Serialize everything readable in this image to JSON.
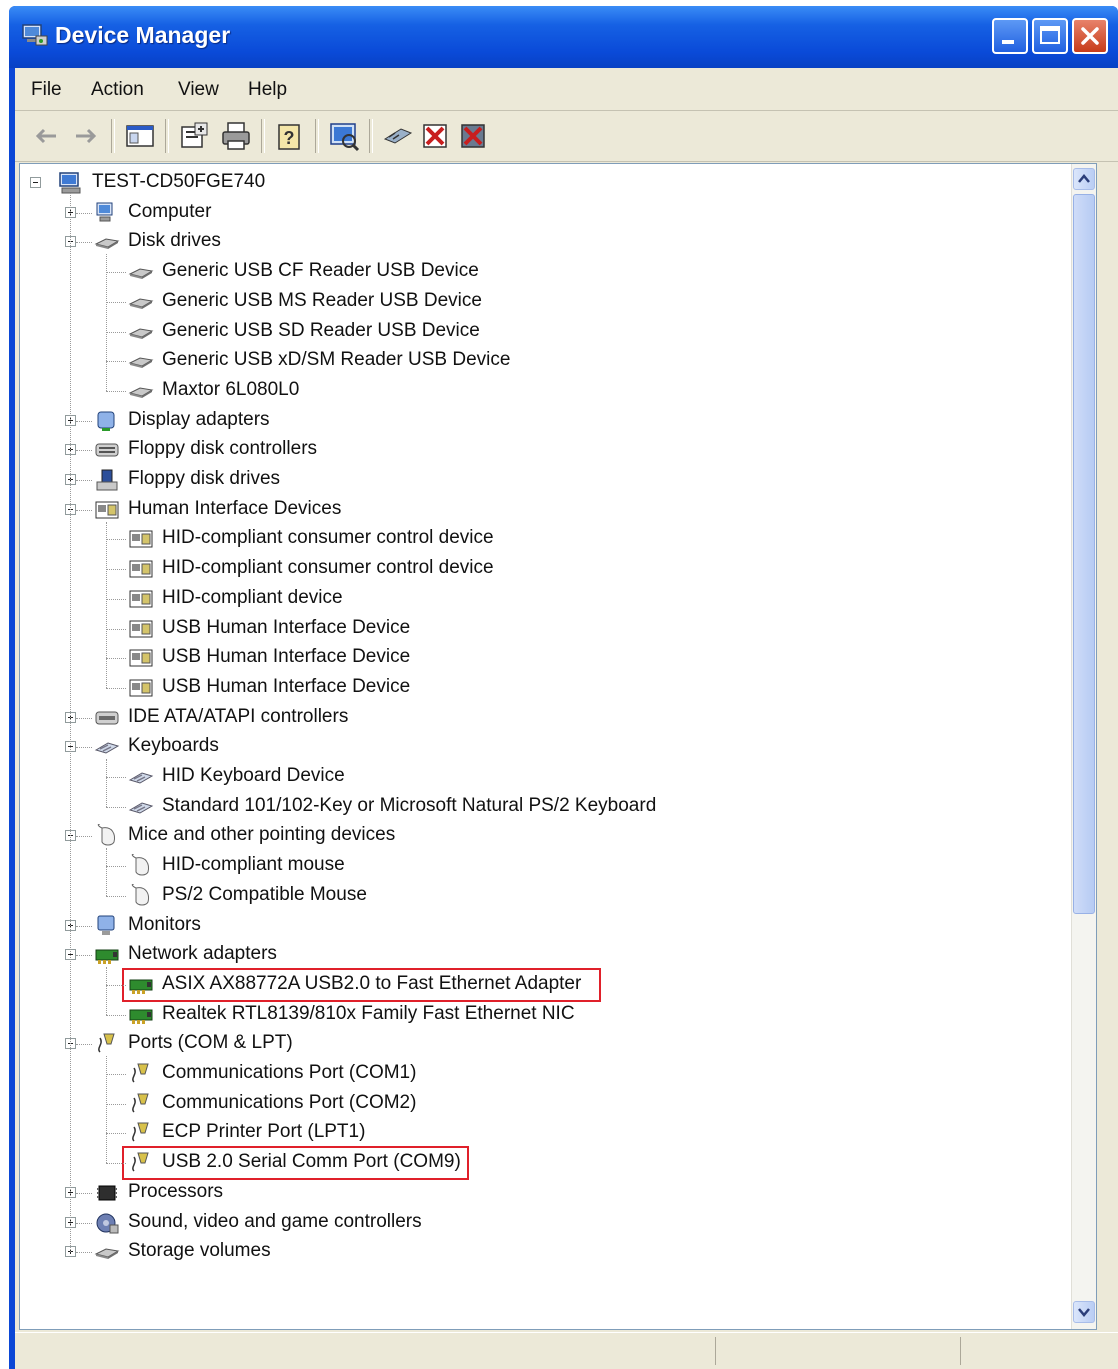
{
  "window": {
    "title": "Device Manager"
  },
  "menu": [
    "File",
    "Action",
    "View",
    "Help"
  ],
  "toolbar": [
    "back-arrow-icon",
    "forward-arrow-icon",
    "console-tree-icon",
    "properties-icon",
    "print-icon",
    "help-icon",
    "scan-hardware-icon",
    "update-driver-icon",
    "disable-device-icon",
    "uninstall-device-icon"
  ],
  "tree": {
    "root": "TEST-CD50FGE740",
    "categories": [
      {
        "label": "Computer",
        "icon": "computer-icon",
        "expanded": false,
        "children": []
      },
      {
        "label": "Disk drives",
        "icon": "disk-drive-icon",
        "expanded": true,
        "children": [
          {
            "label": "Generic USB CF Reader USB Device",
            "icon": "disk-drive-icon"
          },
          {
            "label": "Generic USB MS Reader USB Device",
            "icon": "disk-drive-icon"
          },
          {
            "label": "Generic USB SD Reader USB Device",
            "icon": "disk-drive-icon"
          },
          {
            "label": "Generic USB xD/SM Reader USB Device",
            "icon": "disk-drive-icon"
          },
          {
            "label": "Maxtor 6L080L0",
            "icon": "disk-drive-icon"
          }
        ]
      },
      {
        "label": "Display adapters",
        "icon": "display-adapter-icon",
        "expanded": false,
        "children": []
      },
      {
        "label": "Floppy disk controllers",
        "icon": "floppy-controller-icon",
        "expanded": false,
        "children": []
      },
      {
        "label": "Floppy disk drives",
        "icon": "floppy-drive-icon",
        "expanded": false,
        "children": []
      },
      {
        "label": "Human Interface Devices",
        "icon": "hid-icon",
        "expanded": true,
        "children": [
          {
            "label": "HID-compliant consumer control device",
            "icon": "hid-icon"
          },
          {
            "label": "HID-compliant consumer control device",
            "icon": "hid-icon"
          },
          {
            "label": "HID-compliant device",
            "icon": "hid-icon"
          },
          {
            "label": "USB Human Interface Device",
            "icon": "hid-icon"
          },
          {
            "label": "USB Human Interface Device",
            "icon": "hid-icon"
          },
          {
            "label": "USB Human Interface Device",
            "icon": "hid-icon"
          }
        ]
      },
      {
        "label": "IDE ATA/ATAPI controllers",
        "icon": "ide-controller-icon",
        "expanded": false,
        "children": []
      },
      {
        "label": "Keyboards",
        "icon": "keyboard-icon",
        "expanded": true,
        "children": [
          {
            "label": "HID Keyboard Device",
            "icon": "keyboard-icon"
          },
          {
            "label": "Standard 101/102-Key or Microsoft Natural PS/2 Keyboard",
            "icon": "keyboard-icon"
          }
        ]
      },
      {
        "label": "Mice and other pointing devices",
        "icon": "mouse-icon",
        "expanded": true,
        "children": [
          {
            "label": "HID-compliant mouse",
            "icon": "mouse-icon"
          },
          {
            "label": "PS/2 Compatible Mouse",
            "icon": "mouse-icon"
          }
        ]
      },
      {
        "label": "Monitors",
        "icon": "monitor-icon",
        "expanded": false,
        "children": []
      },
      {
        "label": "Network adapters",
        "icon": "network-adapter-icon",
        "expanded": true,
        "children": [
          {
            "label": "ASIX AX88772A USB2.0 to Fast Ethernet Adapter",
            "icon": "network-adapter-icon",
            "highlighted": true
          },
          {
            "label": "Realtek RTL8139/810x Family Fast Ethernet NIC",
            "icon": "network-adapter-icon"
          }
        ]
      },
      {
        "label": "Ports (COM & LPT)",
        "icon": "port-icon",
        "expanded": true,
        "children": [
          {
            "label": "Communications Port (COM1)",
            "icon": "port-icon"
          },
          {
            "label": "Communications Port (COM2)",
            "icon": "port-icon"
          },
          {
            "label": "ECP Printer Port (LPT1)",
            "icon": "port-icon"
          },
          {
            "label": "USB 2.0 Serial Comm Port (COM9)",
            "icon": "port-icon",
            "highlighted": true
          }
        ]
      },
      {
        "label": "Processors",
        "icon": "processor-icon",
        "expanded": false,
        "children": []
      },
      {
        "label": "Sound, video and game controllers",
        "icon": "sound-icon",
        "expanded": false,
        "children": []
      },
      {
        "label": "Storage volumes",
        "icon": "storage-volume-icon",
        "expanded": false,
        "children": []
      }
    ]
  },
  "colors": {
    "title_bar": "#0a4ad8",
    "highlight_box": "#e0202a",
    "window_face": "#ece9d8"
  }
}
